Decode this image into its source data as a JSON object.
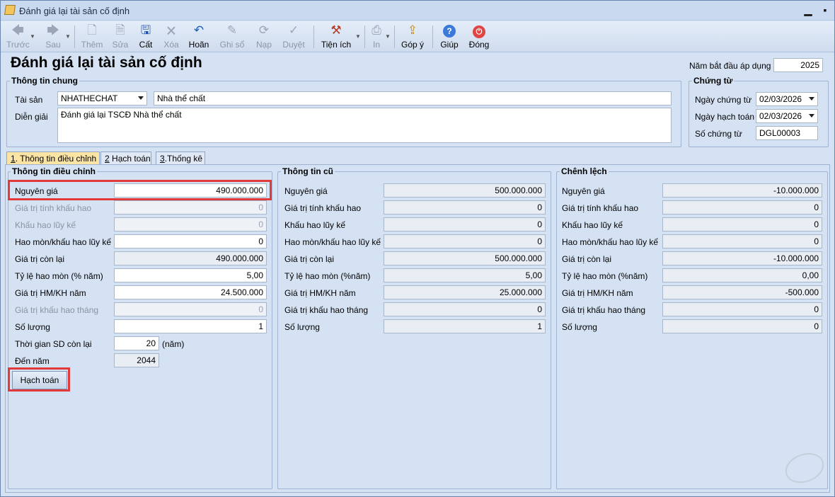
{
  "window": {
    "title": "Đánh giá lại tài sản cố định"
  },
  "toolbar": {
    "prev": "Trước",
    "next": "Sau",
    "add": "Thêm",
    "edit": "Sửa",
    "save": "Cất",
    "delete": "Xóa",
    "undo": "Hoãn",
    "post": "Ghi sổ",
    "reload": "Nạp",
    "approve": "Duyệt",
    "utilities": "Tiện ích",
    "print": "In",
    "feedback": "Góp ý",
    "help": "Giúp",
    "close": "Đóng"
  },
  "page_title": "Đánh giá lại tài sản cố định",
  "start_year": {
    "label": "Năm bắt đầu áp dụng",
    "value": "2025"
  },
  "general": {
    "title": "Thông tin chung",
    "asset_label": "Tài sản",
    "asset_code": "NHATHECHAT",
    "asset_name": "Nhà thể chất",
    "desc_label": "Diễn giải",
    "desc_value": "Đánh giá lại TSCĐ Nhà thể chất"
  },
  "voucher": {
    "title": "Chứng từ",
    "date_label": "Ngày chứng từ",
    "date_value": "02/03/2026",
    "post_date_label": "Ngày hạch toán",
    "post_date_value": "02/03/2026",
    "number_label": "Số chứng từ",
    "number_value": "DGL00003"
  },
  "tabs": [
    {
      "key": "1",
      "label": ". Thông tin điều chỉnh"
    },
    {
      "key": "2",
      "label": " Hạch toán"
    },
    {
      "key": "3",
      "label": ".Thống kê"
    }
  ],
  "adjust": {
    "title": "Thông tin điều chỉnh",
    "original_cost_label": "Nguyên giá",
    "original_cost": "490.000.000",
    "depr_base_label": "Giá trị tính khấu hao",
    "depr_base": "0",
    "accum_depr_label": "Khấu hao lũy kế",
    "accum_depr": "0",
    "wear_accum_label": "Hao mòn/khấu hao lũy kế",
    "wear_accum": "0",
    "remaining_label": "Giá trị còn lại",
    "remaining": "490.000.000",
    "rate_label": "Tỷ lệ hao mòn (% năm)",
    "rate": "5,00",
    "annual_label": "Giá trị HM/KH năm",
    "annual": "24.500.000",
    "monthly_label": "Giá trị khấu hao tháng",
    "monthly": "0",
    "qty_label": "Số lượng",
    "qty": "1",
    "life_label": "Thời gian SD còn lại",
    "life": "20",
    "life_unit": "(năm)",
    "end_year_label": "Đến năm",
    "end_year": "2044",
    "post_button": "Hạch toán"
  },
  "old": {
    "title": "Thông tin cũ",
    "original_cost_label": "Nguyên giá",
    "original_cost": "500.000.000",
    "depr_base_label": "Giá trị tính khấu hao",
    "depr_base": "0",
    "accum_depr_label": "Khấu hao lũy kế",
    "accum_depr": "0",
    "wear_accum_label": "Hao mòn/khấu hao lũy kế",
    "wear_accum": "0",
    "remaining_label": "Giá trị còn lại",
    "remaining": "500.000.000",
    "rate_label": "Tỷ lệ hao mòn (%năm)",
    "rate": "5,00",
    "annual_label": "Giá trị HM/KH năm",
    "annual": "25.000.000",
    "monthly_label": "Giá trị khấu hao tháng",
    "monthly": "0",
    "qty_label": "Số lượng",
    "qty": "1"
  },
  "diff": {
    "title": "Chênh lệch",
    "original_cost_label": "Nguyên giá",
    "original_cost": "-10.000.000",
    "depr_base_label": "Giá trị tính khấu hao",
    "depr_base": "0",
    "accum_depr_label": "Khấu hao lũy kế",
    "accum_depr": "0",
    "wear_accum_label": "Hao mòn/khấu hao lũy kế",
    "wear_accum": "0",
    "remaining_label": "Giá trị còn lại",
    "remaining": "-10.000.000",
    "rate_label": "Tỷ lệ hao mòn (%năm)",
    "rate": "0,00",
    "annual_label": "Giá trị HM/KH năm",
    "annual": "-500.000",
    "monthly_label": "Giá trị khấu hao tháng",
    "monthly": "0",
    "qty_label": "Số lượng",
    "qty": "0"
  },
  "icons": {
    "prev": "arrow-left-icon",
    "next": "arrow-right-icon",
    "add": "new-document-icon",
    "edit": "edit-document-icon",
    "save": "floppy-disk-icon",
    "delete": "delete-document-icon",
    "undo": "undo-arrow-icon",
    "post": "pencil-icon",
    "reload": "refresh-icon",
    "approve": "check-icon",
    "utilities": "tools-icon",
    "print": "printer-icon",
    "feedback": "upload-icon",
    "help": "help-icon",
    "close": "power-icon"
  },
  "colors": {
    "highlight": "#e03a3a",
    "active_tab": "#fbe4a4",
    "help_blue": "#3b7ad8",
    "close_red": "#e04545"
  }
}
